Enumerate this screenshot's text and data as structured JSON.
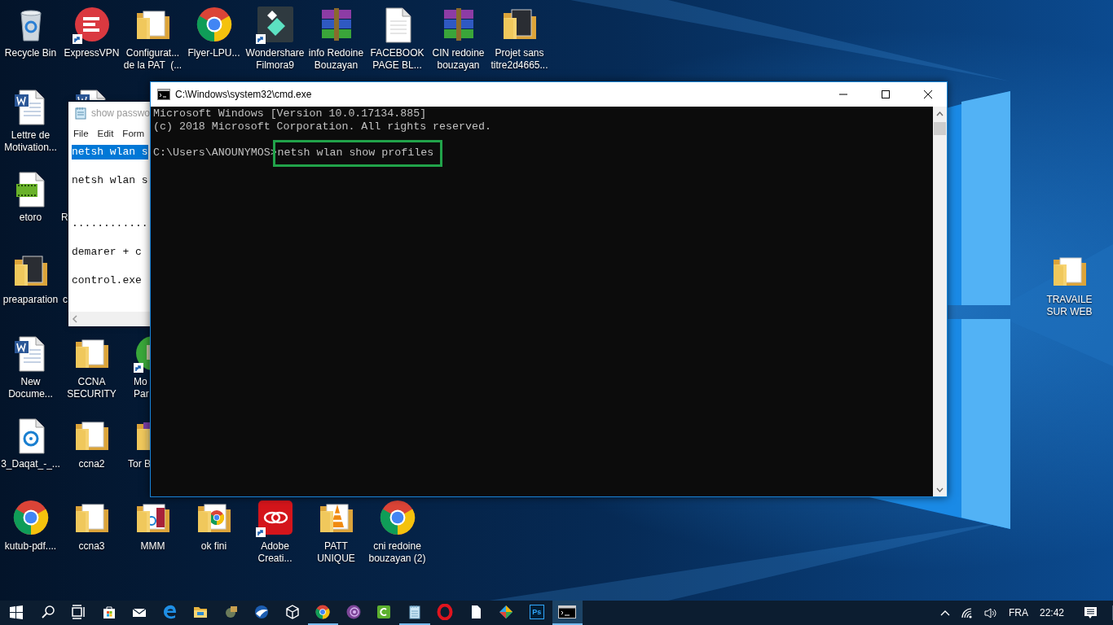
{
  "desktop_icons": [
    {
      "label": "Recycle Bin",
      "kind": "recycle",
      "shortcut": false
    },
    {
      "label": "ExpressVPN",
      "kind": "vpn",
      "shortcut": true
    },
    {
      "label": "Configurat...\nde la PAT  (...",
      "kind": "folder",
      "shortcut": false
    },
    {
      "label": "Flyer-LPU...",
      "kind": "chrome",
      "shortcut": false
    },
    {
      "label": "Wondershare\nFilmora9",
      "kind": "filmora",
      "shortcut": true
    },
    {
      "label": "info Redoine\nBouzayan",
      "kind": "archive",
      "shortcut": false
    },
    {
      "label": "FACEBOOK\nPAGE BL...",
      "kind": "document",
      "shortcut": false
    },
    {
      "label": "CIN redoine\nbouzayan",
      "kind": "archive",
      "shortcut": false
    },
    {
      "label": "Projet sans\ntitre2d4665...",
      "kind": "photo-folder",
      "shortcut": false
    },
    {
      "label": "Lettre de\nMotivation...",
      "kind": "word",
      "shortcut": false
    },
    {
      "kind": "word",
      "shortcut": false
    },
    {
      "label": "etoro",
      "kind": "video",
      "shortcut": false
    },
    {
      "label": "R"
    },
    {
      "label": "preaparation",
      "kind": "photo-folder",
      "shortcut": false
    },
    {
      "label": "c"
    },
    {
      "label": "TRAVAILE\nSUR WEB",
      "kind": "folder",
      "shortcut": false
    },
    {
      "label": "New\nDocume...",
      "kind": "word",
      "shortcut": false
    },
    {
      "label": "CCNA\nSECURITY",
      "kind": "folder",
      "shortcut": false
    },
    {
      "label": "Mo\nPar",
      "kind": "green-app",
      "shortcut": true
    },
    {
      "label": "3_Daqat_-_...",
      "kind": "media",
      "shortcut": false
    },
    {
      "label": "ccna2",
      "kind": "folder",
      "shortcut": false
    },
    {
      "label": "Tor B",
      "kind": "tor-folder",
      "shortcut": false
    },
    {
      "label": "kutub-pdf....",
      "kind": "chrome",
      "shortcut": false
    },
    {
      "label": "ccna3",
      "kind": "folder",
      "shortcut": false
    },
    {
      "label": "MMM",
      "kind": "media-folder",
      "shortcut": false
    },
    {
      "label": "ok fini",
      "kind": "chrome-folder",
      "shortcut": false
    },
    {
      "label": "Adobe\nCreati...",
      "kind": "adobe",
      "shortcut": true
    },
    {
      "label": "PATT\nUNIQUE",
      "kind": "vlc-folder",
      "shortcut": false
    },
    {
      "label": "cni redoine\nbouzayan (2)",
      "kind": "chrome",
      "shortcut": false
    }
  ],
  "notepad": {
    "title": "show passwo",
    "menu": [
      "File",
      "Edit",
      "Form"
    ],
    "lines": [
      {
        "text": "netsh wlan s",
        "selected": true
      },
      {
        "text": "netsh wlan s",
        "selected": false
      },
      {
        "text": "............",
        "selected": false
      },
      {
        "text": "demarer + c",
        "selected": false
      },
      {
        "text": "control.exe",
        "selected": false
      }
    ]
  },
  "cmd": {
    "title": "C:\\Windows\\system32\\cmd.exe",
    "output_lines": [
      "Microsoft Windows [Version 10.0.17134.885]",
      "(c) 2018 Microsoft Corporation. All rights reserved."
    ],
    "prompt": "C:\\Users\\ANOUNYMOS>",
    "command": "netsh wlan show profiles",
    "command_highlighted": true
  },
  "taskbar": {
    "items": [
      {
        "kind": "start",
        "running": false,
        "active": false
      },
      {
        "kind": "search",
        "running": false,
        "active": false
      },
      {
        "kind": "task-view",
        "running": false,
        "active": false
      },
      {
        "kind": "store",
        "running": false,
        "active": false
      },
      {
        "kind": "mail",
        "running": false,
        "active": false
      },
      {
        "kind": "edge",
        "running": false,
        "active": false
      },
      {
        "kind": "explorer",
        "running": false,
        "active": false
      },
      {
        "kind": "tool",
        "running": false,
        "active": false
      },
      {
        "kind": "bird",
        "running": false,
        "active": false
      },
      {
        "kind": "cube",
        "running": false,
        "active": false
      },
      {
        "kind": "chrome",
        "running": true,
        "active": false
      },
      {
        "kind": "tor",
        "running": false,
        "active": false
      },
      {
        "kind": "camtasia",
        "running": false,
        "active": false
      },
      {
        "kind": "notepad",
        "running": true,
        "active": false
      },
      {
        "kind": "opera",
        "running": false,
        "active": false
      },
      {
        "kind": "file",
        "running": false,
        "active": false
      },
      {
        "kind": "diamond",
        "running": false,
        "active": false
      },
      {
        "kind": "photoshop",
        "label": "Ps",
        "running": false,
        "active": false
      },
      {
        "kind": "terminal",
        "running": true,
        "active": true
      }
    ],
    "language": "FRA",
    "time": "22:42"
  }
}
